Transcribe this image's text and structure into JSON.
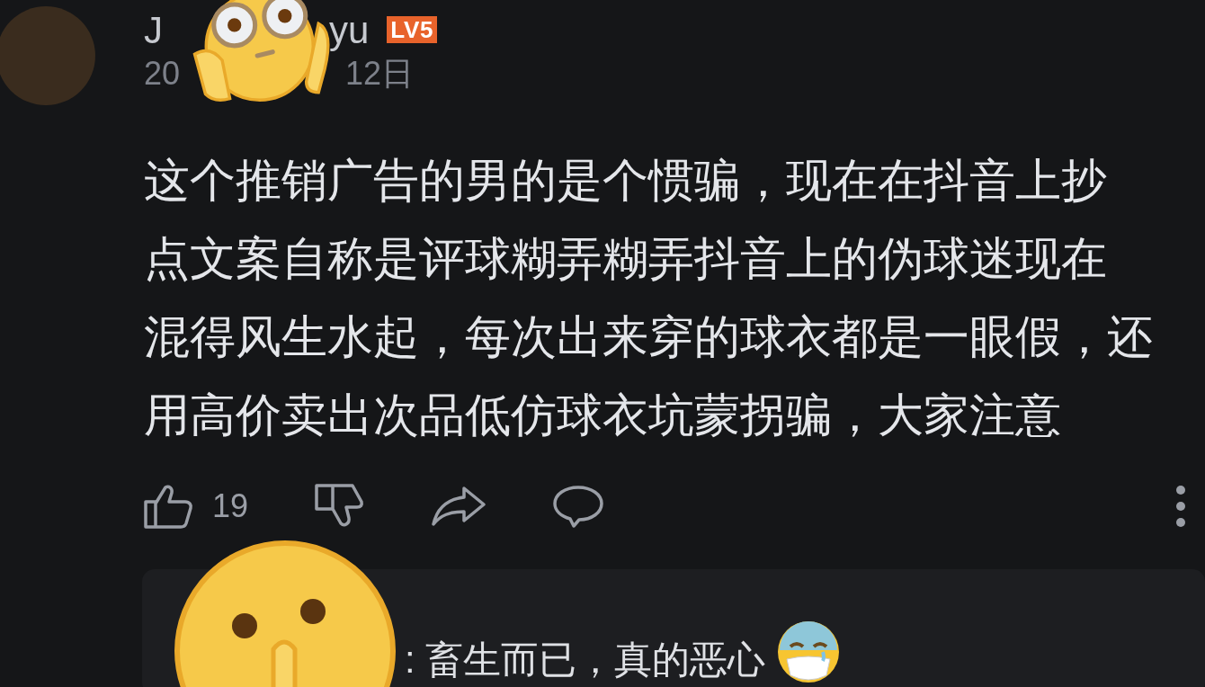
{
  "comment": {
    "username_parts": [
      "J",
      "yu"
    ],
    "level_badge": "LV5",
    "date_parts": [
      "20",
      "12日"
    ],
    "body_lines": [
      "这个推销广告的男的是个惯骗，现在在抖音上抄",
      "点文案自称是评球糊弄糊弄抖音上的伪球迷现在",
      "混得风生水起，每次出来穿的球衣都是一眼假，还",
      "用高价卖出次品低仿球衣坑蒙拐骗，大家注意"
    ],
    "like_count": "19"
  },
  "reply": {
    "text": ": 畜生而已，真的恶心"
  }
}
